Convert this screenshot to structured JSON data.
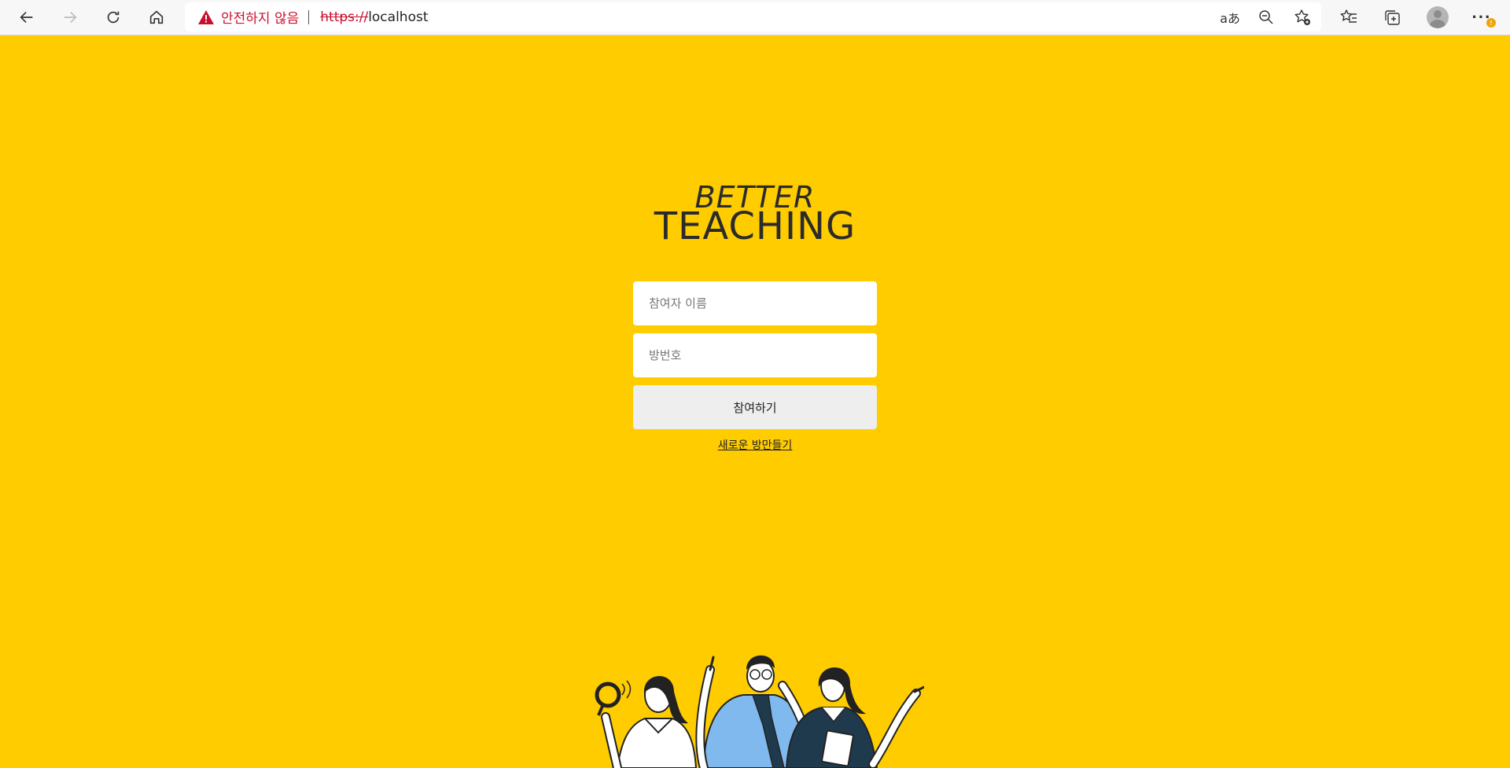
{
  "browser": {
    "security_warning": "안전하지 않음",
    "url_scheme": "https://",
    "url_host": "localhost",
    "icons": [
      "back-icon",
      "forward-icon",
      "refresh-icon",
      "home-icon",
      "warning-icon",
      "read-aloud-icon",
      "zoom-out-icon",
      "add-favorite-icon",
      "favorites-icon",
      "collections-icon",
      "profile-icon",
      "more-icon"
    ],
    "read_aloud_glyph": "aあ",
    "more_glyph": "···",
    "badge": "!"
  },
  "page": {
    "background_color": "#ffcc00",
    "logo_line1": "BETTER",
    "logo_line2": "TEACHING",
    "name_placeholder": "참여자 이름",
    "room_placeholder": "방번호",
    "join_label": "참여하기",
    "new_room_label": "새로운 방만들기"
  }
}
